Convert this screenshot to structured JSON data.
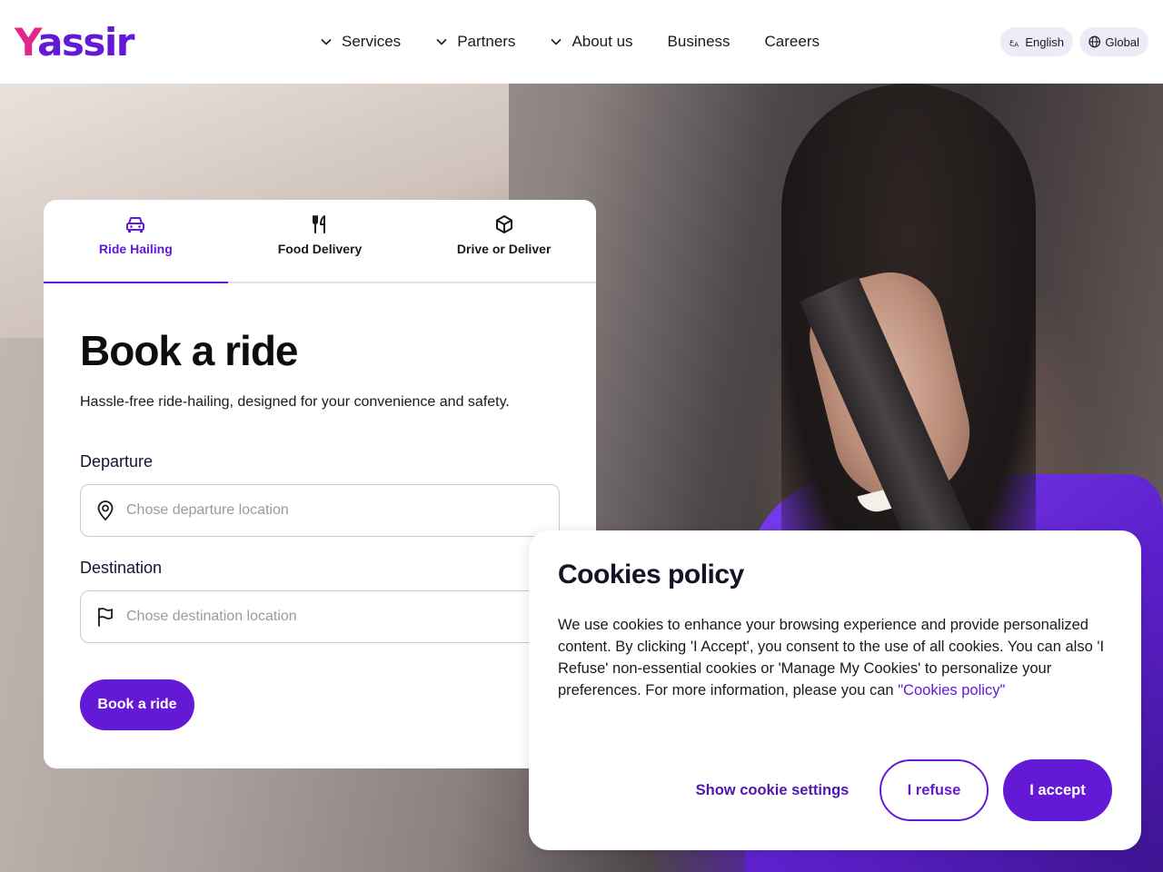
{
  "brand": {
    "logo_text": "Yassir",
    "accent": "#6319d6",
    "logo_pink": "#e3268b"
  },
  "nav": {
    "items": [
      {
        "label": "Services",
        "has_dropdown": true
      },
      {
        "label": "Partners",
        "has_dropdown": true
      },
      {
        "label": "About us",
        "has_dropdown": true
      },
      {
        "label": "Business",
        "has_dropdown": false
      },
      {
        "label": "Careers",
        "has_dropdown": false
      }
    ],
    "language": {
      "label": "English",
      "icon": "translate-icon"
    },
    "region": {
      "label": "Global",
      "icon": "globe-icon"
    }
  },
  "booking": {
    "tabs": [
      {
        "label": "Ride Hailing",
        "icon": "car-icon",
        "active": true
      },
      {
        "label": "Food Delivery",
        "icon": "fork-knife-icon",
        "active": false
      },
      {
        "label": "Drive or Deliver",
        "icon": "package-icon",
        "active": false
      }
    ],
    "title": "Book a ride",
    "subtitle": "Hassle-free ride-hailing, designed for your convenience and safety.",
    "departure": {
      "label": "Departure",
      "placeholder": "Chose departure location",
      "value": "",
      "icon": "location-pin-icon"
    },
    "destination": {
      "label": "Destination",
      "placeholder": "Chose destination location",
      "value": "",
      "icon": "flag-icon"
    },
    "submit_label": "Book a ride"
  },
  "cookies": {
    "title": "Cookies policy",
    "text": "We use cookies to enhance your browsing experience and provide personalized content. By clicking 'I Accept', you consent to the use of all cookies. You can also 'I Refuse' non-essential cookies or 'Manage My Cookies' to personalize your preferences. For more information, please you can",
    "link_label": "\"Cookies policy\"",
    "settings_label": "Show cookie settings",
    "refuse_label": "I refuse",
    "accept_label": "I accept"
  }
}
